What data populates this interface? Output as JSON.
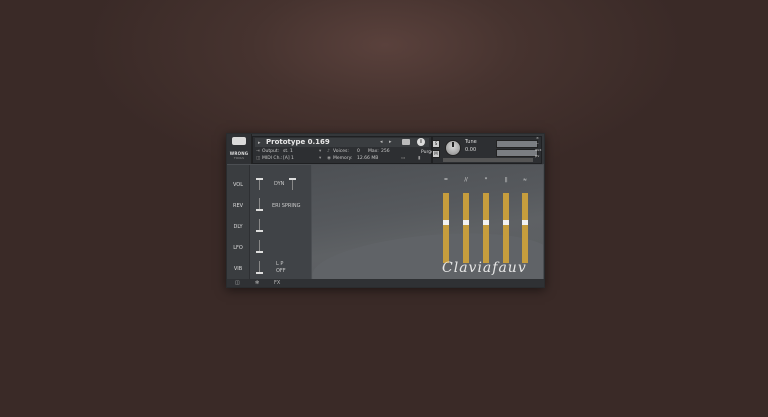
{
  "logo": {
    "line1": "WRONG",
    "line2": "TOOLS"
  },
  "instrument": {
    "title": "Prototype 0.169",
    "output_label": "Output:",
    "output_value": "st. 1",
    "midi_label": "MIDI Ch.:",
    "midi_value": "[A] 1",
    "voices_label": "Voices:",
    "voices_value": "0",
    "max_label": "Max:",
    "max_value": "256",
    "purge_label": "Purge",
    "memory_label": "Memory:",
    "memory_value": "12.66 MB"
  },
  "tune": {
    "label": "Tune",
    "value": "0.00"
  },
  "side_buttons": {
    "aux": "aux",
    "pv": "pv"
  },
  "nav": {
    "items": [
      "VOL",
      "REV",
      "DLY",
      "LFO",
      "VIB"
    ]
  },
  "controls": {
    "dyn": "DYN",
    "reverb_type": "ERI SPRING",
    "lp": "L P",
    "lp_state": "OFF"
  },
  "faders": {
    "labels": [
      "=",
      "//",
      "*",
      "||",
      "≈"
    ],
    "levels": [
      0.62,
      0.62,
      0.62,
      0.62,
      0.62
    ]
  },
  "brand": "Claviafauv",
  "footer": {
    "fx": "FX"
  },
  "colors": {
    "fader": "#c69d3d",
    "handle": "#f2f2f2"
  }
}
